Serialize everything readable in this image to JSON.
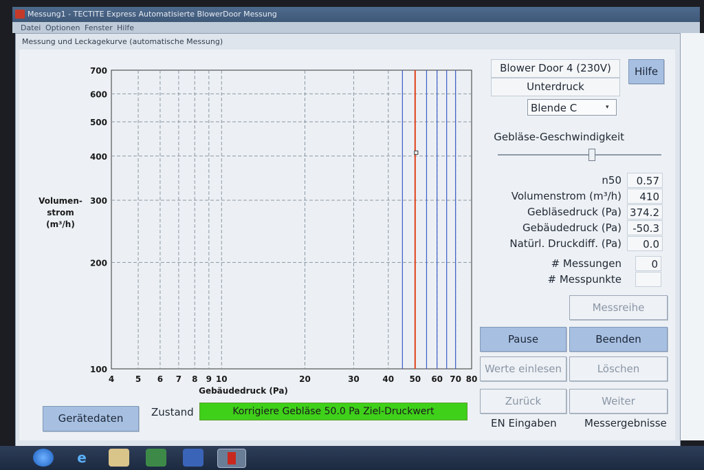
{
  "window": {
    "title": "Messung1 - TECTITE Express Automatisierte BlowerDoor Messung",
    "menu": [
      "Datei",
      "Optionen",
      "Fenster",
      "Hilfe"
    ]
  },
  "dialog": {
    "title": "Messung und Leckagekurve (automatische Messung)"
  },
  "device": {
    "name": "Blower Door 4 (230V)",
    "mode": "Unterdruck",
    "orifice": "Blende C",
    "help_label": "Hilfe",
    "fan_speed_label": "Gebläse-Geschwindigkeit",
    "fan_speed_level": 0.57
  },
  "readings": [
    {
      "label": "n50",
      "value": "0.57"
    },
    {
      "label": "Volumenstrom (m³/h)",
      "value": "410"
    },
    {
      "label": "Gebläsedruck (Pa)",
      "value": "374.2"
    },
    {
      "label": "Gebäudedruck (Pa)",
      "value": "-50.3"
    },
    {
      "label": "Natürl. Druckdiff. (Pa)",
      "value": "0.0"
    },
    {
      "label": "# Messungen",
      "value": "0"
    },
    {
      "label": "# Messpunkte",
      "value": ""
    }
  ],
  "buttons": {
    "messreihe": "Messreihe",
    "pause": "Pause",
    "beenden": "Beenden",
    "werte_einlesen": "Werte einlesen",
    "loeschen": "Löschen",
    "zurueck": "Zurück",
    "weiter": "Weiter",
    "geraetedaten": "Gerätedaten"
  },
  "captions": {
    "en_eingaben": "EN Eingaben",
    "messergebnisse": "Messergebnisse"
  },
  "status": {
    "label": "Zustand",
    "text": "Korrigiere Gebläse 50.0 Pa Ziel-Druckwert",
    "color": "#3fd01a"
  },
  "chart_data": {
    "type": "scatter",
    "xlabel": "Gebäudedruck (Pa)",
    "ylabel_lines": [
      "Volumen-",
      "strom",
      "(m³/h)"
    ],
    "x_scale": "log",
    "y_scale": "log",
    "xlim": [
      4,
      80
    ],
    "ylim": [
      100,
      700
    ],
    "x_ticks": [
      4,
      5,
      6,
      7,
      8,
      9,
      10,
      20,
      30,
      40,
      50,
      60,
      70,
      80
    ],
    "y_ticks": [
      100,
      200,
      300,
      400,
      500,
      600,
      700
    ],
    "target_line_x": 50,
    "target_line_color": "#e0401a",
    "band_lines_x": [
      45,
      55,
      60,
      65,
      70
    ],
    "band_line_color": "#3b5cc8",
    "points": [
      {
        "x": 50.3,
        "y": 410
      }
    ],
    "grid": true
  }
}
